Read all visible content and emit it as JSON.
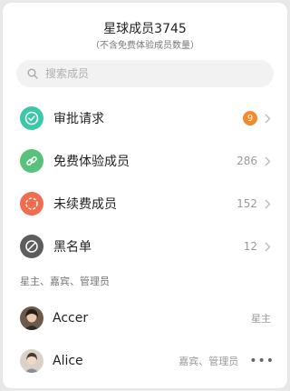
{
  "header": {
    "title": "星球成员3745",
    "subtitle": "（不含免费体验成员数量）"
  },
  "search": {
    "placeholder": "搜索成员"
  },
  "rows": [
    {
      "label": "审批请求",
      "badge": "9",
      "icon": "check-circle-icon",
      "color": "#3cc8a8"
    },
    {
      "label": "免费体验成员",
      "count": "286",
      "icon": "link-icon",
      "color": "#58c17c"
    },
    {
      "label": "未续费成员",
      "count": "152",
      "icon": "dashed-circle-icon",
      "color": "#f26d4e"
    },
    {
      "label": "黑名单",
      "count": "12",
      "icon": "blocked-icon",
      "color": "#5d5d5d"
    }
  ],
  "section": {
    "title": "星主、嘉宾、管理员"
  },
  "members": [
    {
      "name": "Accer",
      "role": "星主"
    },
    {
      "name": "Alice",
      "role": "嘉宾、管理员",
      "more": "•••"
    }
  ],
  "colors": {
    "badge": "#f6892c",
    "panel": "#ffffff",
    "background": "#e8e8e8"
  }
}
